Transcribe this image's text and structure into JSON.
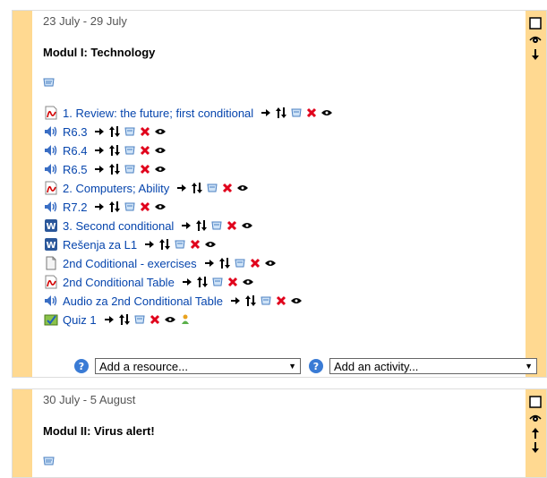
{
  "sections": [
    {
      "week": "23 July - 29 July",
      "title": "Modul I: Technology",
      "activities": [
        {
          "icon": "pdf-icon",
          "label": "1. Review: the future; first conditional"
        },
        {
          "icon": "audio-icon",
          "label": "R6.3"
        },
        {
          "icon": "audio-icon",
          "label": "R6.4"
        },
        {
          "icon": "audio-icon",
          "label": "R6.5"
        },
        {
          "icon": "pdf-icon",
          "label": "2. Computers; Ability"
        },
        {
          "icon": "audio-icon",
          "label": "R7.2"
        },
        {
          "icon": "word-icon",
          "label": "3. Second conditional"
        },
        {
          "icon": "word-icon",
          "label": "Rešenja za L1"
        },
        {
          "icon": "page-icon",
          "label": "2nd Coditional - exercises"
        },
        {
          "icon": "pdf-icon",
          "label": "2nd Conditional Table"
        },
        {
          "icon": "audio-icon",
          "label": "Audio za 2nd Conditional Table"
        },
        {
          "icon": "quiz-icon",
          "label": "Quiz 1"
        }
      ],
      "add_resource": "Add a resource...",
      "add_activity": "Add an activity..."
    },
    {
      "week": "30 July - 5 August",
      "title": "Modul II: Virus alert!"
    }
  ],
  "colors": {
    "section_side": "#ffd991",
    "link": "#0645ad",
    "delete": "#e0001b"
  }
}
